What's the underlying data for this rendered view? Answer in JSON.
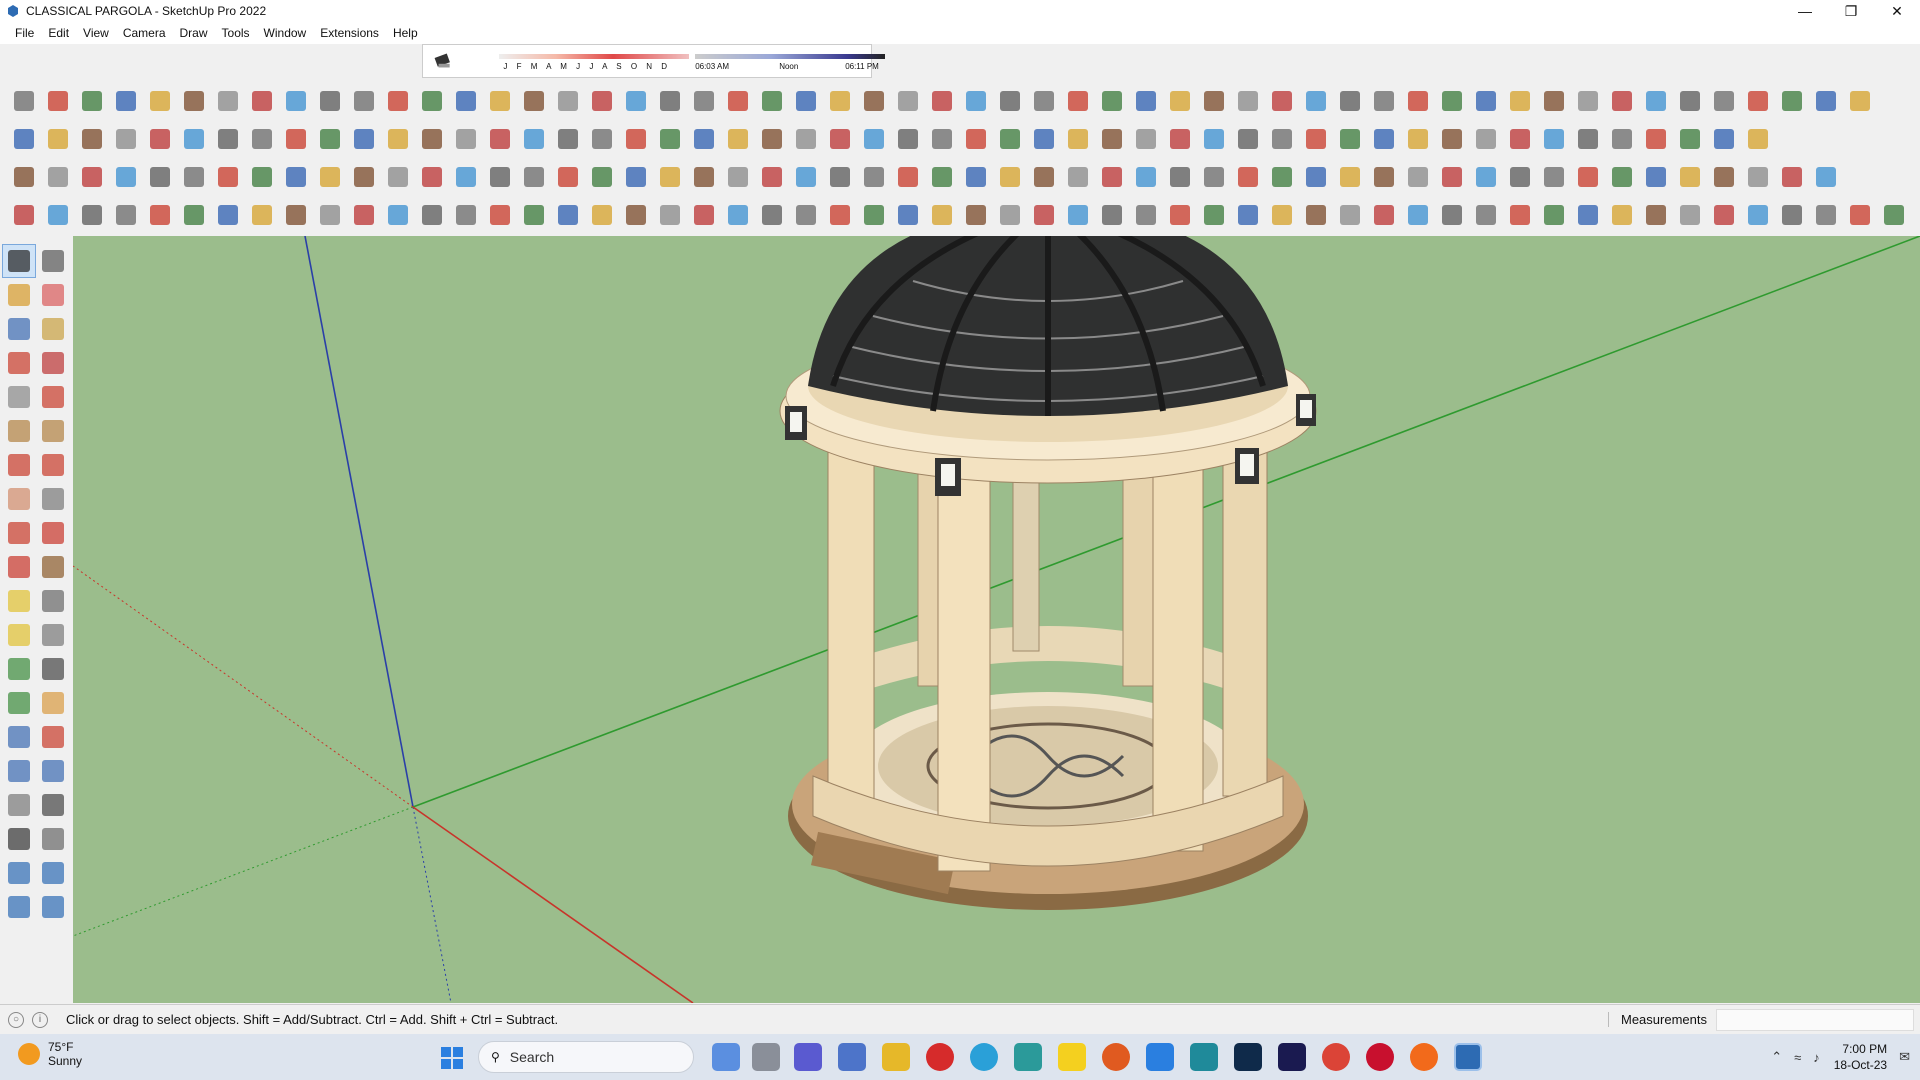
{
  "window": {
    "title": "CLASSICAL PARGOLA - SketchUp Pro 2022",
    "controls": [
      "minimize-icon",
      "restore-icon",
      "close-icon"
    ]
  },
  "menu": [
    "File",
    "Edit",
    "View",
    "Camera",
    "Draw",
    "Tools",
    "Window",
    "Extensions",
    "Help"
  ],
  "shadows": {
    "months": "J F M A M J J A S O N D",
    "time_start": "06:03 AM",
    "time_mid": "Noon",
    "time_end": "06:11 PM"
  },
  "status": {
    "message": "Click or drag to select objects. Shift = Add/Subtract. Ctrl = Add. Shift + Ctrl = Subtract.",
    "measurements_label": "Measurements",
    "measurements_value": ""
  },
  "taskbar": {
    "weather_temp": "75°F",
    "weather_cond": "Sunny",
    "search_label": "Search",
    "time": "7:00 PM",
    "date": "18-Oct-23"
  },
  "colors": {
    "viewport_ground": "#9bbd8c",
    "axis_red": "#c8342a",
    "axis_green": "#2f9a2f",
    "axis_blue": "#2a3fa8"
  }
}
